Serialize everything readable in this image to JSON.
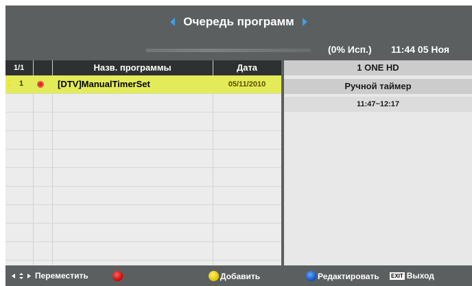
{
  "header": {
    "title": "Очередь программ",
    "usage": "(0% Исп.)",
    "clock": "11:44 05 Ноя"
  },
  "table": {
    "count": "1/1",
    "col_name": "Назв. программы",
    "col_date": "Дата",
    "rows": [
      {
        "num": "1",
        "name": "[DTV]ManualTimerSet",
        "date": "05/11/2010"
      }
    ]
  },
  "panel": {
    "channel": "1 ONE HD",
    "type": "Ручной таймер",
    "time": "11:47~12:17"
  },
  "footer": {
    "move": "Переместить",
    "add": "Добавить",
    "edit": "Редактировать",
    "exit_key": "EXIT",
    "exit": "Выход"
  },
  "colors": {
    "background": "#5b5f5f",
    "selected_row": "#e3ec58",
    "accent_arrow": "#3fa0e4",
    "record_icon": "#d82a1e"
  },
  "icons": [
    "left-arrow-icon",
    "right-arrow-icon",
    "record-icon",
    "red-button-icon",
    "yellow-button-icon",
    "blue-button-icon",
    "navigate-icon"
  ]
}
